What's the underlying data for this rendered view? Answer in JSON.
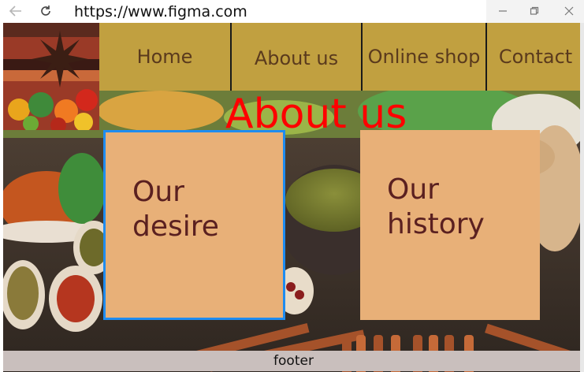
{
  "browser": {
    "url": "https://www.figma.com",
    "icons": {
      "back": "arrow-left-icon",
      "reload": "reload-icon",
      "minimize": "minimize-icon",
      "restore": "restore-icon",
      "close": "close-icon"
    }
  },
  "nav": {
    "items": [
      {
        "label": "Home"
      },
      {
        "label": "About us"
      },
      {
        "label": "Online shop"
      },
      {
        "label": "Contact"
      }
    ]
  },
  "main": {
    "title": "About us",
    "cards": [
      {
        "label": "Our desire"
      },
      {
        "label": "Our history"
      }
    ]
  },
  "footer": {
    "label": "footer"
  },
  "colors": {
    "nav_bg": "#c1a040",
    "nav_text": "#5a3a1d",
    "title": "#ff0000",
    "card_bg": "#e8b078",
    "card_text": "#5a2020",
    "selection": "#1f8cf0",
    "footer_bg": "#c9bfbd"
  }
}
